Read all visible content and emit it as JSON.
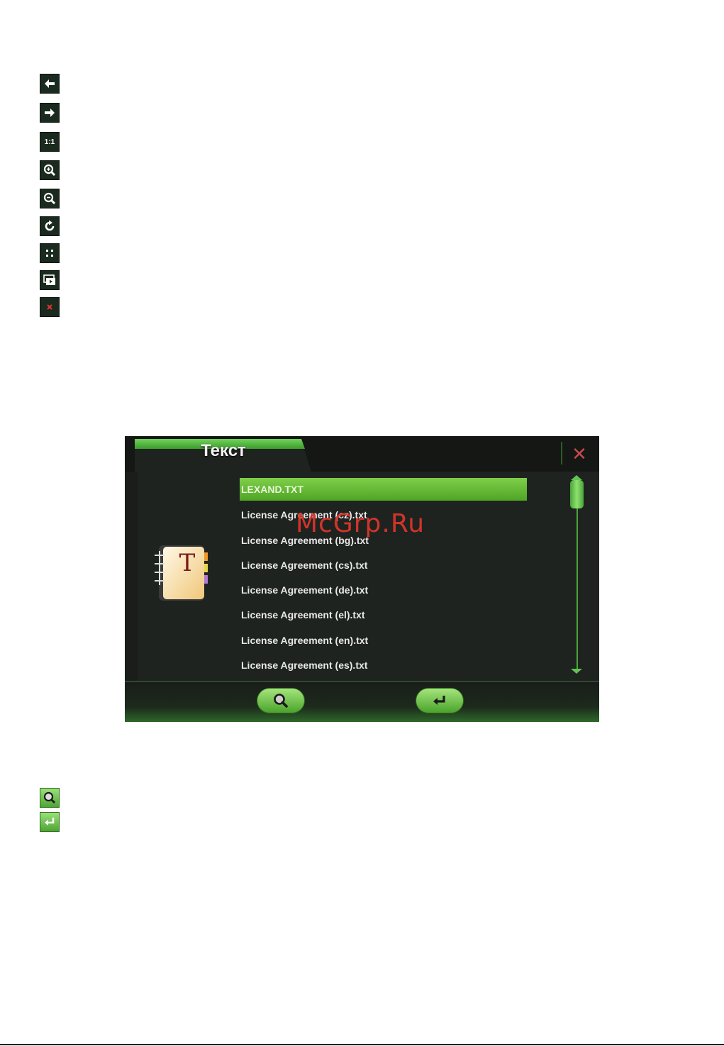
{
  "screen": {
    "tab_title": "Текст",
    "close_glyph": "✕",
    "files": [
      "LEXAND.TXT",
      "License Agreement (cz).txt",
      "License Agreement (bg).txt",
      "License Agreement (cs).txt",
      "License Agreement (de).txt",
      "License Agreement (el).txt",
      "License Agreement (en).txt",
      "License Agreement (es).txt"
    ],
    "selected_index": 0,
    "icon_letter": "T"
  },
  "toolbar_legend_icons": [
    "arrow-left-icon",
    "arrow-right-icon",
    "actual-size-icon",
    "zoom-in-icon",
    "zoom-out-icon",
    "rotate-icon",
    "fit-screen-icon",
    "slideshow-icon",
    "close-icon"
  ],
  "actual_size_label": "1:1",
  "bottom_legend_icons": [
    "search-icon",
    "back-icon"
  ],
  "watermark": "McGrp.Ru",
  "colors": {
    "accent_green": "#4ea524",
    "close_red": "#c5494a",
    "dark_bg": "#1f231f"
  }
}
